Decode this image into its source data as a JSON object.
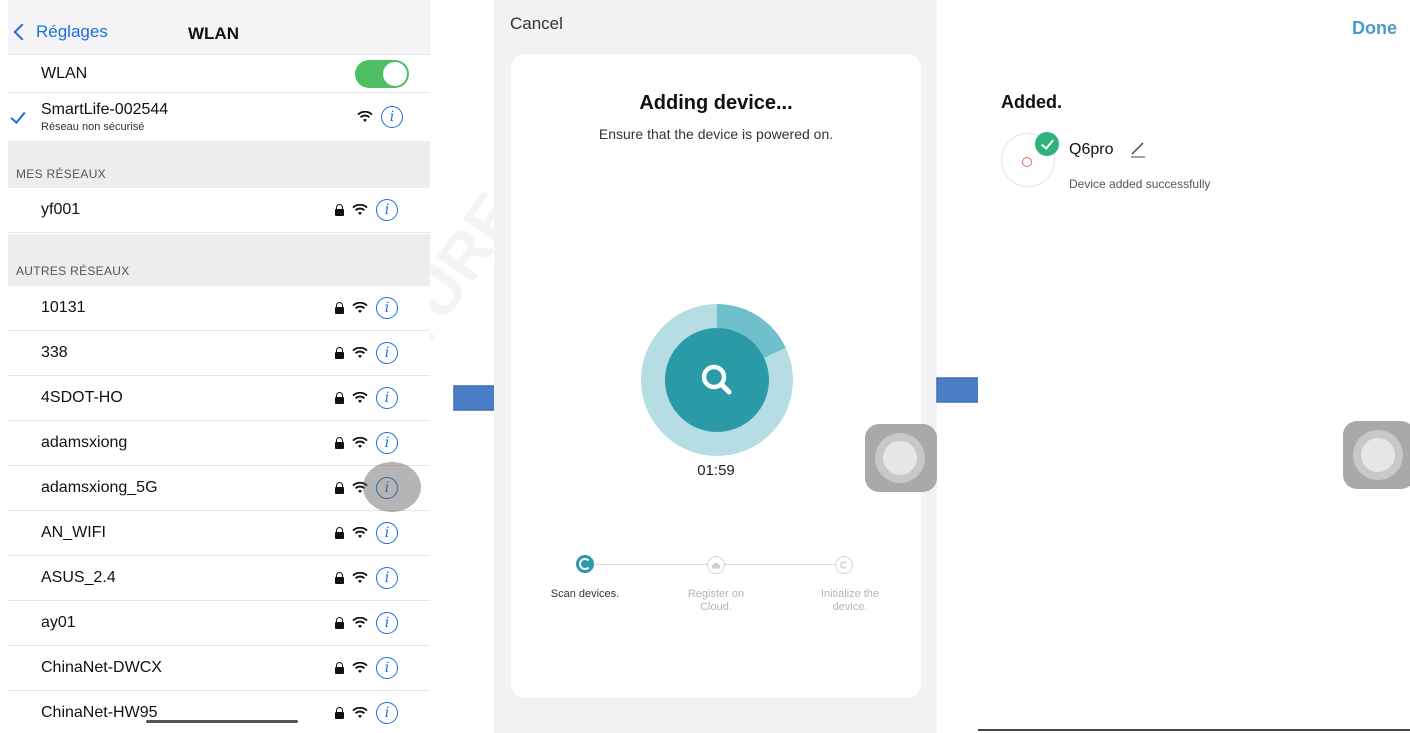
{
  "wifi": {
    "back_label": "Réglages",
    "title": "WLAN",
    "wlan_label": "WLAN",
    "wlan_enabled": true,
    "connected": {
      "name": "SmartLife-002544",
      "subtitle": "Réseau non sécurisé"
    },
    "my_networks_header": "MES RÉSEAUX",
    "my_networks": [
      {
        "name": "yf001"
      }
    ],
    "other_networks_header": "AUTRES RÉSEAUX",
    "other_networks": [
      {
        "name": "10131"
      },
      {
        "name": "338"
      },
      {
        "name": "4SDOT-HO"
      },
      {
        "name": "adamsxiong"
      },
      {
        "name": "adamsxiong_5G"
      },
      {
        "name": "AN_WIFI"
      },
      {
        "name": "ASUS_2.4"
      },
      {
        "name": "ay01"
      },
      {
        "name": "ChinaNet-DWCX"
      },
      {
        "name": "ChinaNet-HW95"
      }
    ],
    "info_glyph": "i"
  },
  "adding": {
    "cancel_label": "Cancel",
    "title": "Adding device...",
    "subtitle": "Ensure that the device is powered on.",
    "timer": "01:59",
    "progress": 0.18,
    "steps": [
      {
        "label": "Scan devices.",
        "state": "active"
      },
      {
        "label": "Register on Cloud.",
        "state": "pending"
      },
      {
        "label": "Initialize the device.",
        "state": "pending"
      }
    ],
    "step_icons": [
      "spinner-icon",
      "cloud-icon",
      "initialize-icon"
    ]
  },
  "added": {
    "done_label": "Done",
    "title": "Added.",
    "device_name": "Q6pro",
    "device_status": "Device added successfully"
  },
  "watermark": "HONITURE",
  "colors": {
    "ios_blue": "#1a6fe0",
    "toggle_green": "#4fbe63",
    "teal": "#2a9aa7",
    "teal_light": "#b5dde3",
    "done_blue": "#4a9cc4",
    "success_green": "#2fb37a",
    "arrow_blue": "#4a7fc8"
  }
}
